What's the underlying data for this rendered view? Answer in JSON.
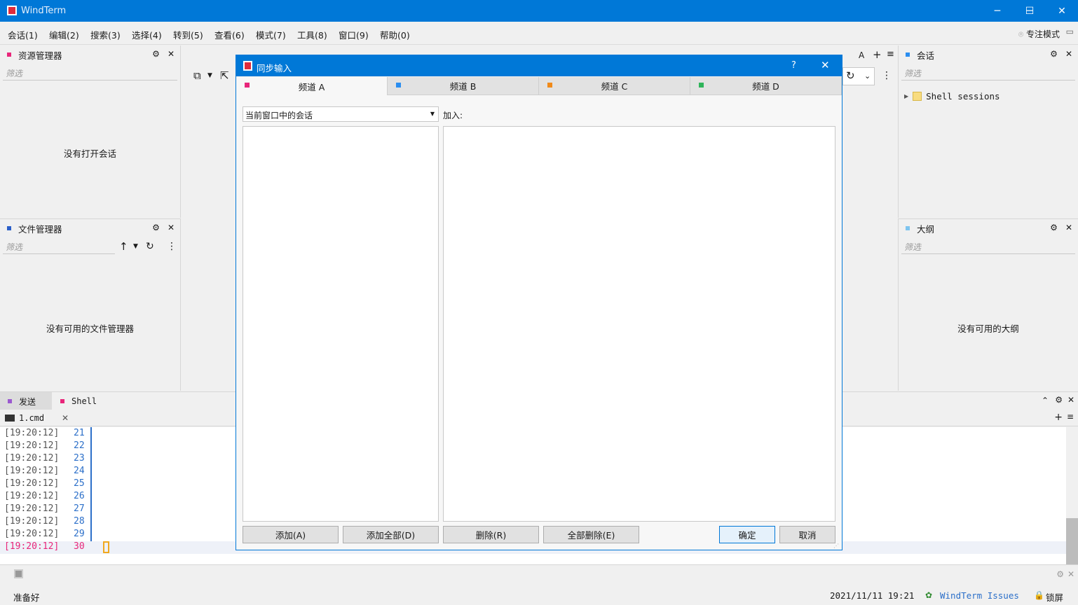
{
  "window": {
    "title": "WindTerm"
  },
  "menu": [
    "会话(1)",
    "编辑(2)",
    "搜索(3)",
    "选择(4)",
    "转到(5)",
    "查看(6)",
    "模式(7)",
    "工具(8)",
    "窗口(9)",
    "帮助(0)"
  ],
  "focus_mode": "专注模式",
  "explorer": {
    "title": "资源管理器",
    "filter_placeholder": "筛选",
    "empty": "没有打开会话"
  },
  "file_manager": {
    "title": "文件管理器",
    "filter_placeholder": "筛选",
    "empty": "没有可用的文件管理器"
  },
  "sessions_panel": {
    "title": "会话",
    "filter_placeholder": "筛选",
    "tree_item": "Shell sessions"
  },
  "outline_panel": {
    "title": "大纲",
    "filter_placeholder": "筛选",
    "empty": "没有可用的大纲"
  },
  "top_right_icons": {
    "font": "A"
  },
  "dialog": {
    "title": "同步输入",
    "help": "?",
    "tabs": [
      {
        "label": "频道 A",
        "color": "#e8267a"
      },
      {
        "label": "频道 B",
        "color": "#2b8ef0"
      },
      {
        "label": "频道 C",
        "color": "#f08a1a"
      },
      {
        "label": "频道 D",
        "color": "#2fb45a"
      }
    ],
    "source_select": "当前窗口中的会话",
    "join_label": "加入:",
    "buttons": {
      "add": "添加(A)",
      "add_all": "添加全部(D)",
      "remove": "删除(R)",
      "remove_all": "全部删除(E)",
      "ok": "确定",
      "cancel": "取消"
    }
  },
  "bottom_tabs": {
    "send": "发送",
    "shell": "Shell"
  },
  "term_tab": {
    "label": "1.cmd"
  },
  "terminal": {
    "lines": [
      {
        "ts": "[19:20:12]",
        "n": "21"
      },
      {
        "ts": "[19:20:12]",
        "n": "22"
      },
      {
        "ts": "[19:20:12]",
        "n": "23"
      },
      {
        "ts": "[19:20:12]",
        "n": "24"
      },
      {
        "ts": "[19:20:12]",
        "n": "25"
      },
      {
        "ts": "[19:20:12]",
        "n": "26"
      },
      {
        "ts": "[19:20:12]",
        "n": "27"
      },
      {
        "ts": "[19:20:12]",
        "n": "28"
      },
      {
        "ts": "[19:20:12]",
        "n": "29"
      },
      {
        "ts": "[19:20:12]",
        "n": "30"
      }
    ]
  },
  "status": {
    "ready": "准备好",
    "datetime": "2021/11/11 19:21",
    "issues": "WindTerm Issues",
    "lock": "锁屏"
  }
}
